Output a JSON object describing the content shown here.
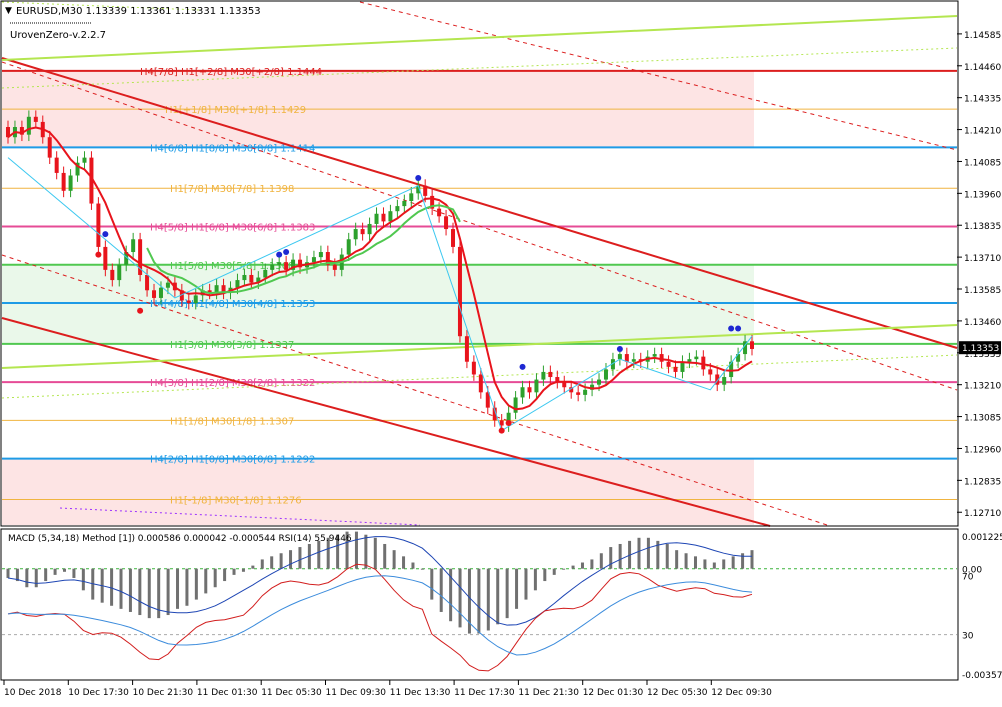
{
  "header": {
    "symbol_line": "EURUSD,M30  1.13339 1.13361 1.13331 1.13353",
    "indicator_name": "UrovenZero-v.2.2.7"
  },
  "colors": {
    "bull": "#2ca02c",
    "bear": "#e8141c",
    "level_red": "#dc1e1e",
    "level_orange": "#f0b440",
    "level_cyan": "#1e9be6",
    "level_pink": "#e64b96",
    "level_green": "#50c850",
    "channel": "#dc1e1e",
    "lime": "#b4e650",
    "macd_hist": "#707070",
    "price_badge_bg": "#000000"
  },
  "chart_data": [
    {
      "type": "candlestick",
      "title": "EURUSD,M30",
      "ohlc_current": {
        "open": 1.13339,
        "high": 1.13361,
        "low": 1.13331,
        "close": 1.13353
      },
      "ylim": [
        1.1266,
        1.1471
      ],
      "y_ticks": [
        "1.14585",
        "1.14460",
        "1.14335",
        "1.14210",
        "1.14085",
        "1.13960",
        "1.13835",
        "1.13710",
        "1.13585",
        "1.13460",
        "1.13335",
        "1.13210",
        "1.13085",
        "1.12960",
        "1.12835",
        "1.12710"
      ],
      "y_tick_values": [
        1.14585,
        1.1446,
        1.14335,
        1.1421,
        1.14085,
        1.1396,
        1.13835,
        1.1371,
        1.13585,
        1.1346,
        1.13335,
        1.1321,
        1.13085,
        1.1296,
        1.12835,
        1.1271
      ],
      "current_price": "1.13353",
      "x_ticks": [
        "10 Dec 2018",
        "10 Dec 17:30",
        "10 Dec 21:30",
        "11 Dec 01:30",
        "11 Dec 05:30",
        "11 Dec 09:30",
        "11 Dec 13:30",
        "11 Dec 17:30",
        "11 Dec 21:30",
        "12 Dec 01:30",
        "12 Dec 05:30",
        "12 Dec 09:30"
      ],
      "levels": [
        {
          "label": "H4[7/8] H1[+2/8] M30[+2/8] 1.1444",
          "value": 1.1444,
          "color": "red"
        },
        {
          "label": "H1[+1/8] M30[+1/8] 1.1429",
          "value": 1.1429,
          "color": "orange"
        },
        {
          "label": "H4[6/8] H1[8/8] M30[8/8] 1.1414",
          "value": 1.1414,
          "color": "cyan"
        },
        {
          "label": "H1[7/8] M30[7/8] 1.1398",
          "value": 1.1398,
          "color": "orange"
        },
        {
          "label": "H4[5/8] H1[6/8] M30[6/8] 1.1383",
          "value": 1.1383,
          "color": "pink"
        },
        {
          "label": "H1[5/8] M30[5/8] 1.1368",
          "value": 1.1368,
          "color": "green"
        },
        {
          "label": "H4[4/8] H1[4/8] M30[4/8] 1.1353",
          "value": 1.1353,
          "color": "cyan"
        },
        {
          "label": "H1[3/8] M30[3/8] 1.1337",
          "value": 1.1337,
          "color": "green"
        },
        {
          "label": "H4[3/8] H1[2/8] M30[2/8] 1.1322",
          "value": 1.1322,
          "color": "pink"
        },
        {
          "label": "H1[1/8] M30[1/8] 1.1307",
          "value": 1.1307,
          "color": "orange"
        },
        {
          "label": "H4[2/8] H1[0/8] M30[0/8] 1.1292",
          "value": 1.1292,
          "color": "cyan"
        },
        {
          "label": "H1[-1/8] M30[-1/8] 1.1276",
          "value": 1.1276,
          "color": "orange"
        }
      ],
      "closes": [
        1.1418,
        1.1422,
        1.1419,
        1.1426,
        1.1424,
        1.1418,
        1.141,
        1.1404,
        1.1397,
        1.1403,
        1.1408,
        1.141,
        1.1392,
        1.1375,
        1.1366,
        1.1362,
        1.1368,
        1.1373,
        1.1378,
        1.1364,
        1.1358,
        1.1355,
        1.1359,
        1.1361,
        1.1358,
        1.1354,
        1.1353,
        1.1356,
        1.1358,
        1.1357,
        1.136,
        1.1357,
        1.1359,
        1.1362,
        1.1364,
        1.1361,
        1.1363,
        1.1366,
        1.1368,
        1.1369,
        1.1366,
        1.137,
        1.1367,
        1.1369,
        1.1371,
        1.1373,
        1.1368,
        1.1366,
        1.1372,
        1.1378,
        1.1382,
        1.138,
        1.1384,
        1.1388,
        1.1385,
        1.1389,
        1.1391,
        1.1393,
        1.1396,
        1.1399,
        1.1395,
        1.139,
        1.1387,
        1.1382,
        1.1375,
        1.134,
        1.133,
        1.1325,
        1.1318,
        1.1312,
        1.1307,
        1.1305,
        1.131,
        1.1316,
        1.132,
        1.1318,
        1.1323,
        1.1326,
        1.1324,
        1.1322,
        1.132,
        1.1318,
        1.1317,
        1.1319,
        1.1321,
        1.1323,
        1.1327,
        1.1331,
        1.1333,
        1.133,
        1.1331,
        1.133,
        1.1332,
        1.1333,
        1.133,
        1.1328,
        1.1326,
        1.133,
        1.1331,
        1.1332,
        1.1327,
        1.1325,
        1.1321,
        1.1324,
        1.133,
        1.1333,
        1.1338,
        1.1335
      ]
    },
    {
      "type": "histogram",
      "title": "MACD (5,34,18) Method [1]) 0.000586 0.000042 -0.000544",
      "ylim": [
        -0.00357,
        0.00122
      ],
      "y_ticks": [
        "0.001225",
        "0.00",
        "-0.003574"
      ],
      "macd_line_value": 0.000586,
      "signal_value": 4.2e-05,
      "third_value": -0.000544,
      "histogram": [
        -0.0003,
        -0.0004,
        -0.0006,
        -0.0006,
        -0.0004,
        -0.0002,
        -0.0001,
        -0.0003,
        -0.0007,
        -0.001,
        -0.0011,
        -0.0012,
        -0.0013,
        -0.0014,
        -0.0015,
        -0.0016,
        -0.0016,
        -0.0015,
        -0.0013,
        -0.0012,
        -0.001,
        -0.0008,
        -0.0006,
        -0.0004,
        -0.0002,
        -0.0001,
        0.0001,
        0.0003,
        0.0004,
        0.0005,
        0.0006,
        0.0007,
        0.0008,
        0.0009,
        0.001,
        0.0011,
        0.0012,
        0.0012,
        0.0011,
        0.001,
        0.0008,
        0.0006,
        0.0004,
        0.0002,
        0.0,
        -0.001,
        -0.0014,
        -0.0017,
        -0.0019,
        -0.0021,
        -0.0021,
        -0.002,
        -0.0018,
        -0.0016,
        -0.0013,
        -0.001,
        -0.0007,
        -0.0004,
        -0.0002,
        0.0,
        0.0001,
        0.0002,
        0.0003,
        0.0005,
        0.0007,
        0.0008,
        0.0009,
        0.001,
        0.001,
        0.0009,
        0.0008,
        0.0006,
        0.0005,
        0.0004,
        0.0003,
        0.0002,
        0.0003,
        0.0004,
        0.0005,
        0.0006
      ]
    },
    {
      "type": "line",
      "title": "RSI(14) 55.9446",
      "ylim": [
        0,
        100
      ],
      "y_ticks": [
        "70",
        "30"
      ],
      "levels": [
        70,
        30
      ],
      "current_value": 55.9446
    }
  ]
}
